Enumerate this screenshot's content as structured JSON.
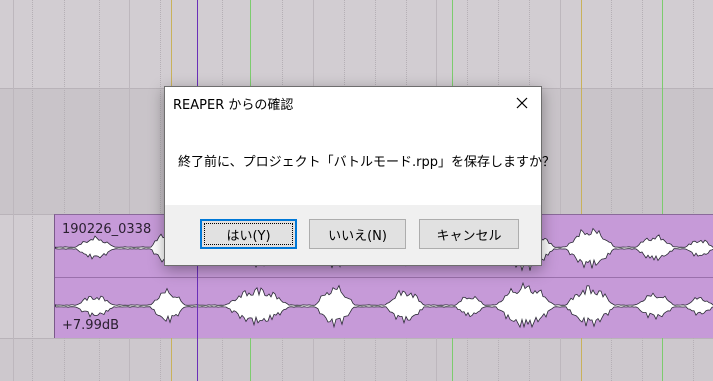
{
  "dialog": {
    "title": "REAPER からの確認",
    "message": "終了前に、プロジェクト「バトルモード.rpp」を保存しますか？",
    "buttons": {
      "yes": "はい(Y)",
      "no": "いいえ(N)",
      "cancel": "キャンセル"
    },
    "close_icon": "close-icon"
  },
  "item": {
    "name": "190226_0338",
    "gain": "+7.99dB"
  },
  "colors": {
    "item_fill": "#c69ad8",
    "waveform": "#ffffff",
    "waveform_outline": "#2a2a35",
    "default_button_border": "#0078d7",
    "cursor_marker": "#6a2fb8",
    "green_marker": "#7ccc6e"
  }
}
